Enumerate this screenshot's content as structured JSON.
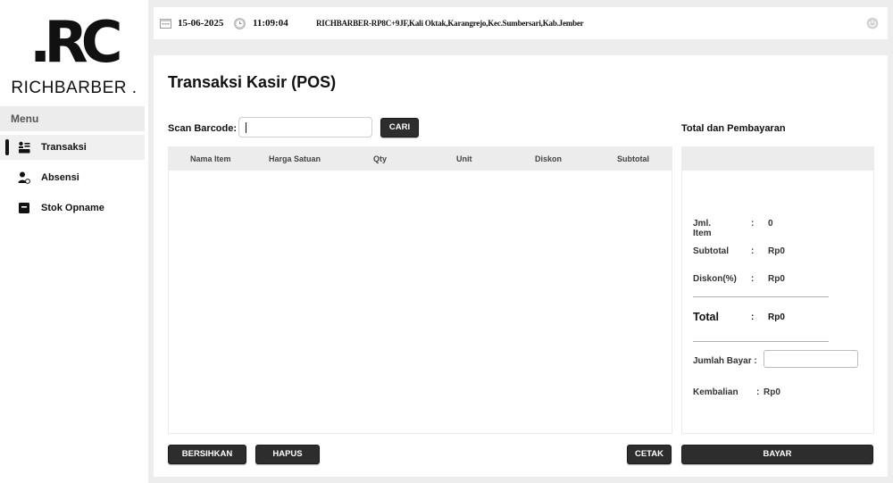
{
  "brand": {
    "mark": ".RC",
    "name": "RICHBARBER ."
  },
  "sidebar": {
    "menu_header": "Menu",
    "items": [
      {
        "label": "Transaksi",
        "icon": "cashier-icon",
        "active": true
      },
      {
        "label": "Absensi",
        "icon": "user-clock-icon",
        "active": false
      },
      {
        "label": "Stok Opname",
        "icon": "archive-box-icon",
        "active": false
      }
    ]
  },
  "topbar": {
    "date": "15-06-2025",
    "time": "11:09:04",
    "address": "RICHBARBER-RP8C+9JF,Kali Oktak,Karangrejo,Kec.Sumbersari,Kab.Jember"
  },
  "main": {
    "title": "Transaksi Kasir (POS)",
    "scan_label": "Scan Barcode:",
    "scan_value": "",
    "search_button": "CARI",
    "table_columns": [
      "Nama Item",
      "Harga Satuan",
      "Qty",
      "Unit",
      "Diskon",
      "Subtotal"
    ],
    "table_rows": []
  },
  "payment": {
    "title": "Total dan Pembayaran",
    "jml_item_label": "Jml. Item",
    "jml_item_value": "0",
    "subtotal_label": "Subtotal",
    "subtotal_value": "Rp0",
    "diskon_label": "Diskon(%)",
    "diskon_value": "Rp0",
    "total_label": "Total",
    "total_value": "Rp0",
    "jumlah_bayar_label": "Jumlah Bayar :",
    "jumlah_bayar_value": "",
    "kembalian_label": "Kembalian",
    "kembalian_value": "Rp0",
    "separator": ":"
  },
  "actions": {
    "clear": "BERSIHKAN",
    "delete": "HAPUS",
    "print": "CETAK",
    "pay": "BAYAR"
  },
  "colors": {
    "accent": "#2d2d2d",
    "panel": "#ececec"
  }
}
